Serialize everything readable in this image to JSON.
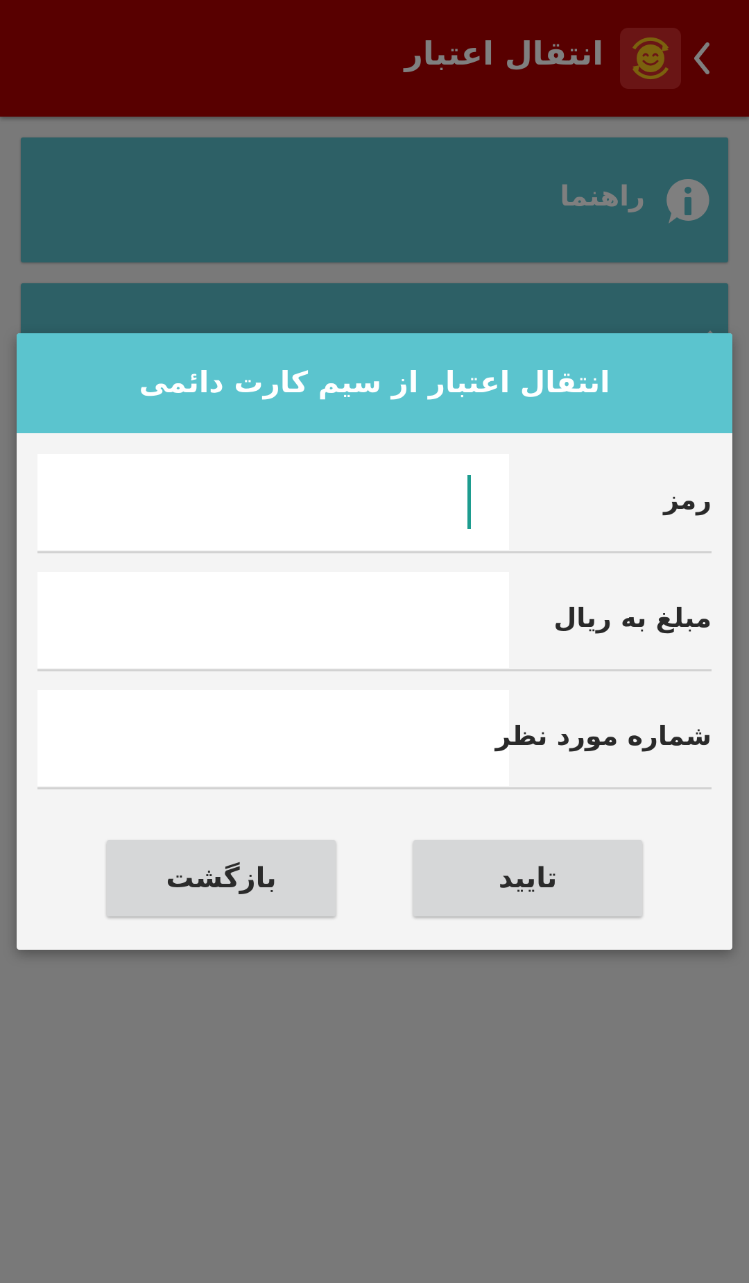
{
  "app_bar": {
    "title": "انتقال اعتبار",
    "background_color": "#b00000"
  },
  "cards": {
    "guide_label": "راهنما",
    "guide_icon": "info-bubble-icon",
    "second_icon": "edit-icon",
    "card_color": "#5bc1cc"
  },
  "dialog": {
    "title": "انتقال اعتبار از سیم کارت دائمی",
    "header_color": "#5bc4ce",
    "fields": {
      "password_label": "رمز",
      "password_value": "",
      "amount_label": "مبلغ به ریال",
      "amount_value": "",
      "number_label": "شماره مورد نظر",
      "number_value": ""
    },
    "buttons": {
      "confirm_label": "تایید",
      "back_label": "بازگشت"
    },
    "cursor_color": "#1d9c8f"
  }
}
